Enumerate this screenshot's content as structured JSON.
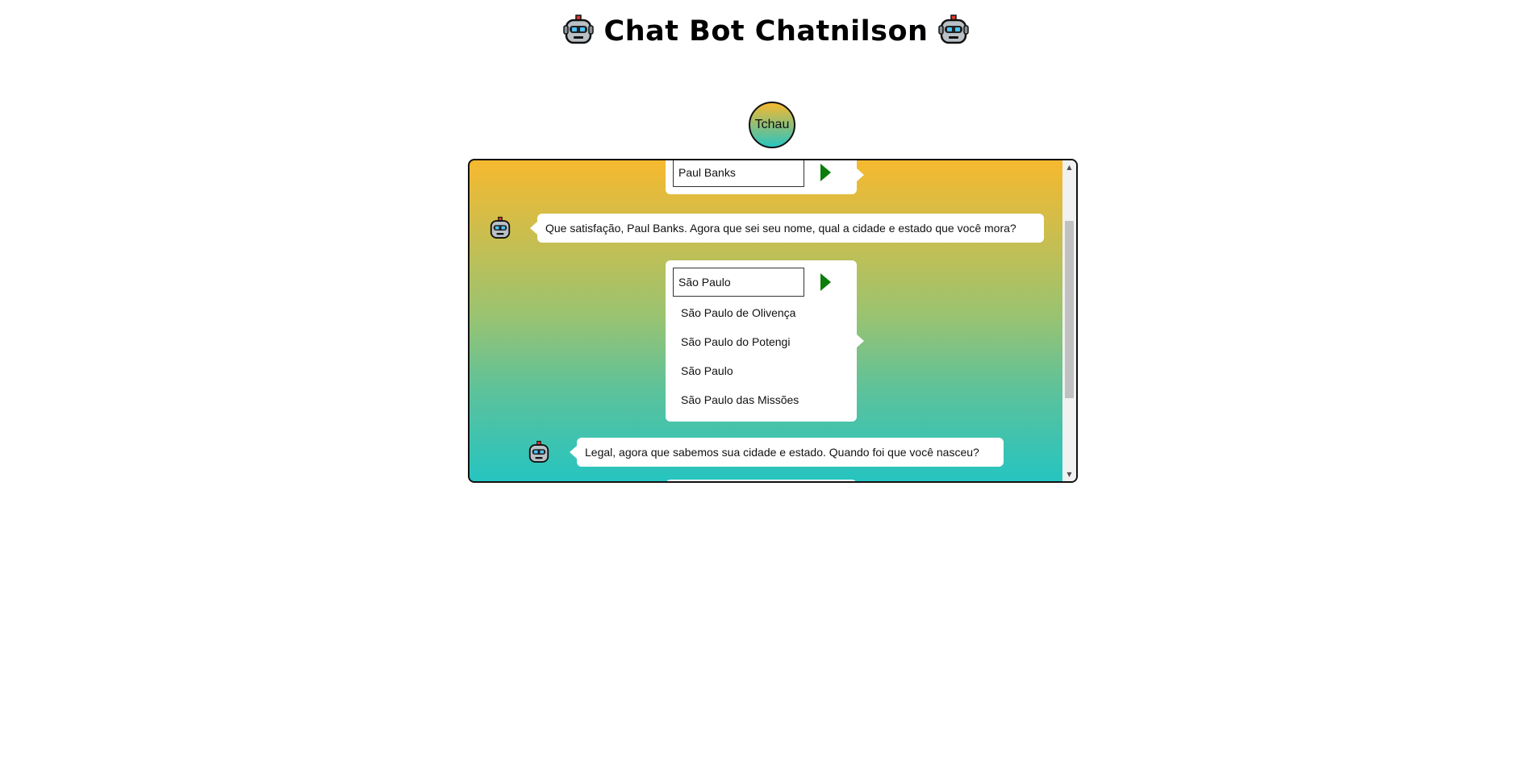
{
  "header": {
    "title": "Chat Bot Chatnilson",
    "left_icon": "robot-icon",
    "right_icon": "robot-icon"
  },
  "controls": {
    "bye_label": "Tchau"
  },
  "colors": {
    "gradient_top": "#f6b92f",
    "gradient_bottom": "#26c4c0",
    "send_arrow": "#0b7d0b"
  },
  "chat": {
    "name_answer": {
      "value": "Paul Banks"
    },
    "bot_message_1": "Que satisfação, Paul Banks. Agora que sei seu nome, qual a cidade e estado que você mora?",
    "city_answer": {
      "value": "São Paulo",
      "suggestions": [
        "São Paulo de Olivença",
        "São Paulo do Potengi",
        "São Paulo",
        "São Paulo das Missões"
      ]
    },
    "bot_message_2": "Legal, agora que sabemos sua cidade e estado. Quando foi que você nasceu?"
  }
}
